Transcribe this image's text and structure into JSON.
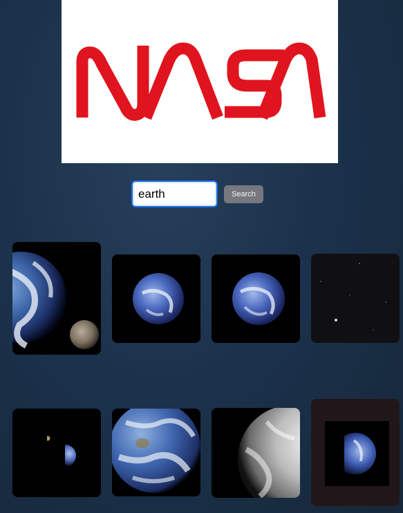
{
  "logo": {
    "name": "NASA",
    "color": "#e0141e"
  },
  "search": {
    "value": "earth",
    "button_label": "Search"
  },
  "results": [
    {
      "subject": "earth-and-moon"
    },
    {
      "subject": "earth"
    },
    {
      "subject": "earth"
    },
    {
      "subject": "starfield"
    },
    {
      "subject": "earth-and-moon-distant"
    },
    {
      "subject": "earth-closeup"
    },
    {
      "subject": "earth-grayscale"
    },
    {
      "subject": "earth-crescent"
    }
  ]
}
